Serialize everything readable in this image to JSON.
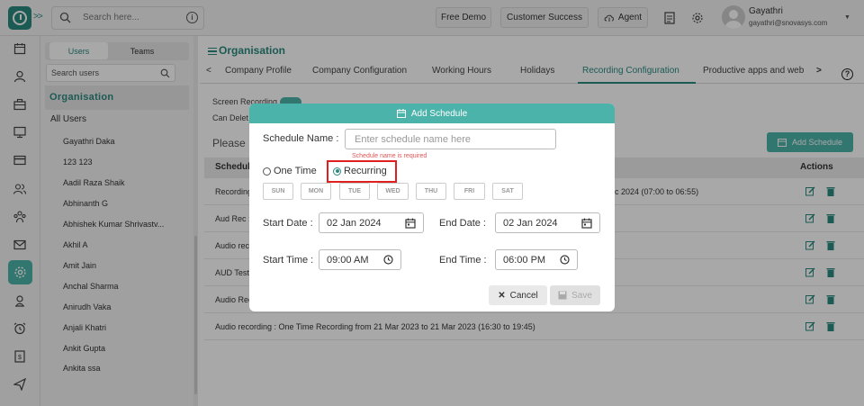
{
  "header": {
    "search_placeholder": "Search here...",
    "free_demo": "Free Demo",
    "customer_success": "Customer Success",
    "agent": "Agent",
    "user_name": "Gayathri",
    "user_email": "gayathri@snovasys.com"
  },
  "sidebar": {
    "tab_users": "Users",
    "tab_teams": "Teams",
    "search_placeholder": "Search users",
    "org_label": "Organisation",
    "all_users": "All Users",
    "users": [
      "Gayathri Daka",
      "123 123",
      "Aadil Raza Shaik",
      "Abhinanth G",
      "Abhishek Kumar Shrivastv...",
      "Akhil A",
      "Amit Jain",
      "Anchal Sharma",
      "Anirudh Vaka",
      "Anjali Khatri",
      "Ankit Gupta",
      "Ankita ssa"
    ]
  },
  "main": {
    "title": "Organisation",
    "tabs": [
      "Company Profile",
      "Company Configuration",
      "Working Hours",
      "Holidays",
      "Recording Configuration",
      "Productive apps and web"
    ],
    "active_tab": "Recording Configuration",
    "screen_recording_label": "Screen Recording",
    "can_delete_label": "Can Delet",
    "please_text": "Please",
    "add_schedule_button": "Add Schedule",
    "table_header_schedule": "Schedule",
    "table_header_actions": "Actions",
    "rows": [
      "Recording",
      "Aud Rec :",
      "Audio rec",
      "AUD Testi",
      "Audio Rec",
      "Audio recording : One Time Recording from 21 Mar 2023 to 21 Mar 2023 (16:30 to 19:45)"
    ],
    "row1_tail": "c 2024 (07:00 to 06:55)"
  },
  "modal": {
    "title": "Add Schedule",
    "schedule_name_label": "Schedule Name :",
    "schedule_name_placeholder": "Enter schedule name here",
    "schedule_name_error": "Schedule name is required",
    "one_time_label": "One Time",
    "recurring_label": "Recurring",
    "selected": "Recurring",
    "days": [
      "SUN",
      "MON",
      "TUE",
      "WED",
      "THU",
      "FRI",
      "SAT"
    ],
    "start_date_label": "Start Date :",
    "start_date_value": "02 Jan 2024",
    "end_date_label": "End Date :",
    "end_date_value": "02 Jan 2024",
    "start_time_label": "Start Time :",
    "start_time_value": "09:00 AM",
    "end_time_label": "End Time :",
    "end_time_value": "06:00 PM",
    "cancel_button": "Cancel",
    "save_button": "Save"
  },
  "colors": {
    "brand": "#2b8a80",
    "accent": "#4cb3ab",
    "highlight": "#e02020",
    "error": "#e05555"
  }
}
